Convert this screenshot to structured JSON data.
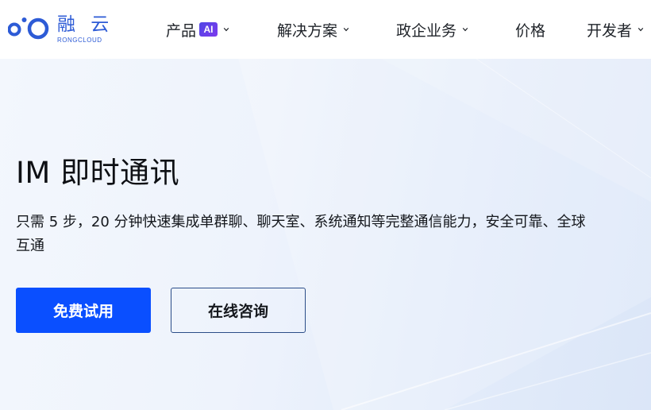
{
  "header": {
    "logo": {
      "name_cn": "融 云",
      "name_en": "RONGCLOUD"
    },
    "nav": [
      {
        "label": "产品",
        "badge": "AI",
        "has_dropdown": true
      },
      {
        "label": "解决方案",
        "has_dropdown": true
      },
      {
        "label": "政企业务",
        "has_dropdown": true
      },
      {
        "label": "价格",
        "has_dropdown": false
      },
      {
        "label": "开发者",
        "has_dropdown": true
      }
    ]
  },
  "hero": {
    "title": "IM 即时通讯",
    "description": "只需 5 步，20 分钟快速集成单群聊、聊天室、系统通知等完整通信能力，安全可靠、全球互通",
    "primary_button": "免费试用",
    "secondary_button": "在线咨询"
  },
  "colors": {
    "brand": "#2d5bd6",
    "primary_button": "#0a4fff",
    "ai_badge": "#5b3ee8"
  },
  "icons": {
    "logo": "rongcloud-logo-icon",
    "dropdown": "chevron-down-icon"
  }
}
